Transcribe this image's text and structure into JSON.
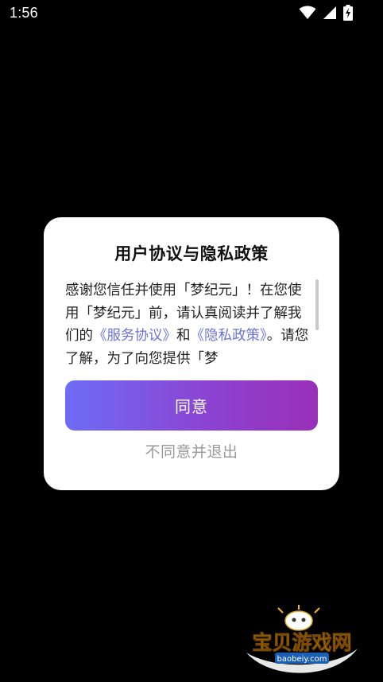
{
  "status_bar": {
    "time": "1:56",
    "icons": [
      "wifi-icon",
      "signal-icon",
      "battery-charging-icon"
    ]
  },
  "dialog": {
    "title": "用户协议与隐私政策",
    "body": {
      "text_1": "感谢您信任并使用「梦纪元」！在您使用「梦纪元」前，请认真阅读并了解我们的",
      "link_service": "《服务协议》",
      "text_2": "和",
      "link_privacy": "《隐私政策》",
      "text_3": "。请您了解，为了向您提供「梦"
    },
    "agree_label": "同意",
    "disagree_label": "不同意并退出"
  },
  "watermark": {
    "brand": "宝贝游戏网",
    "url": "baobeiy.com"
  },
  "colors": {
    "background": "#000000",
    "dialog_bg": "#ffffff",
    "link": "#6c73d6",
    "button_gradient_start": "#6d6cf5",
    "button_gradient_end": "#9a2fb8",
    "disagree_text": "#9a9a9a"
  }
}
